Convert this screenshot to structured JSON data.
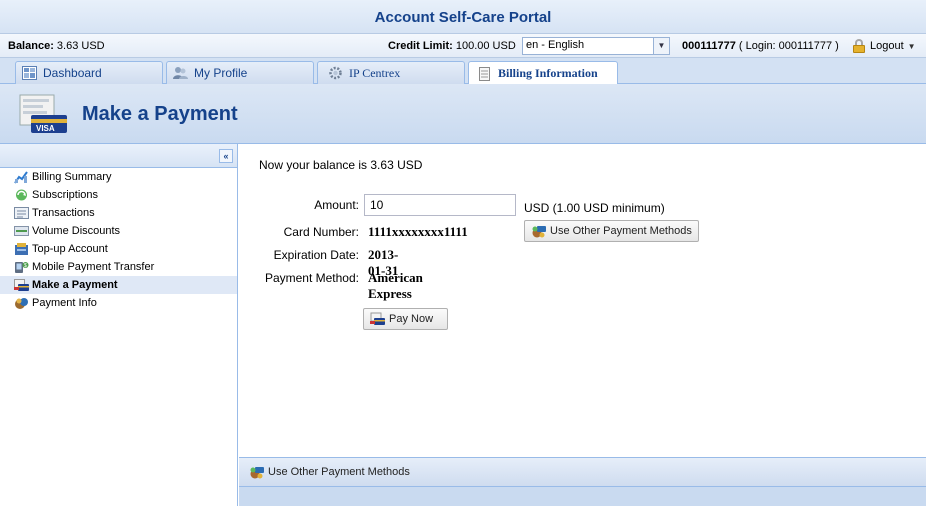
{
  "app": {
    "title": "Account Self-Care Portal"
  },
  "info": {
    "balance_label": "Balance:",
    "balance_value": "3.63 USD",
    "credit_label": "Credit Limit:",
    "credit_value": "100.00 USD",
    "language": "en - English",
    "account": "000111777",
    "login": "( Login: 000111777 )",
    "logout": "Logout"
  },
  "tabs": [
    {
      "label": "Dashboard",
      "icon": "dashboard-icon"
    },
    {
      "label": "My Profile",
      "icon": "users-icon"
    },
    {
      "label": "IP Centrex",
      "icon": "gear-icon"
    },
    {
      "label": "Billing Information",
      "icon": "document-icon",
      "active": true
    }
  ],
  "header": {
    "title": "Make a Payment"
  },
  "sidebar": {
    "collapse": "«",
    "items": [
      {
        "label": "Billing Summary",
        "icon": "chart-icon"
      },
      {
        "label": "Subscriptions",
        "icon": "refresh-icon"
      },
      {
        "label": "Transactions",
        "icon": "list-icon"
      },
      {
        "label": "Volume Discounts",
        "icon": "tag-icon"
      },
      {
        "label": "Top-up Account",
        "icon": "topup-icon"
      },
      {
        "label": "Mobile Payment Transfer",
        "icon": "mobile-icon"
      },
      {
        "label": "Make a Payment",
        "icon": "credit-card-icon",
        "active": true
      },
      {
        "label": "Payment Info",
        "icon": "info-icon"
      }
    ]
  },
  "main": {
    "balance_text": "Now your balance is 3.63 USD",
    "amount_label": "Amount:",
    "amount_value": "10",
    "amount_note": "USD (1.00 USD minimum)",
    "card_label": "Card Number:",
    "card_value": "1111xxxxxxxx1111",
    "exp_label": "Expiration Date:",
    "exp_value": "2013-01-31",
    "method_label": "Payment Method:",
    "method_value": "American Express",
    "other_methods": "Use Other Payment Methods",
    "pay_now": "Pay Now",
    "footer_link": "Use Other Payment Methods"
  },
  "colors": {
    "accent": "#15428b",
    "border": "#99bbe8",
    "active_bg": "#dfe8f6"
  }
}
